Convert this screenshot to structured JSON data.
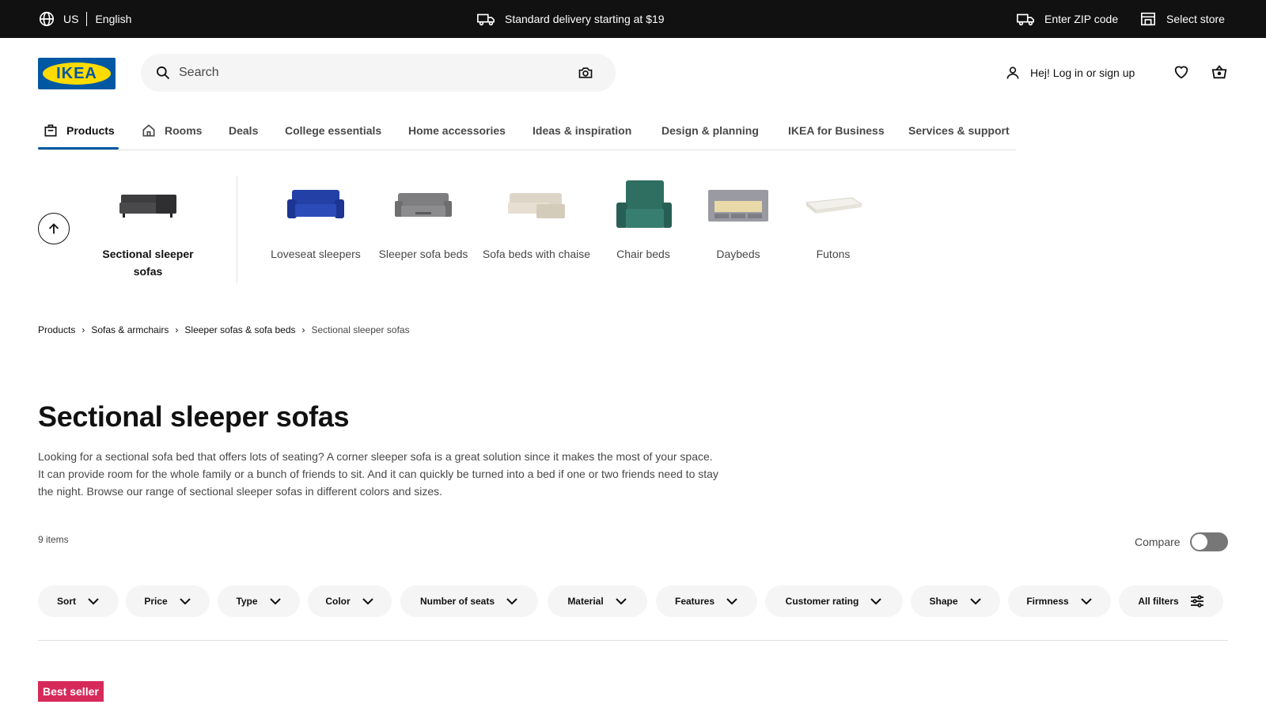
{
  "topbar": {
    "country": "US",
    "language": "English",
    "delivery_text": "Standard delivery starting at $19",
    "zip_label": "Enter ZIP code",
    "store_label": "Select store"
  },
  "header": {
    "logo_text": "IKEA",
    "search_placeholder": "Search",
    "login_label": "Hej! Log in or sign up"
  },
  "nav": {
    "items": [
      {
        "label": "Products"
      },
      {
        "label": "Rooms"
      },
      {
        "label": "Deals"
      },
      {
        "label": "College essentials"
      },
      {
        "label": "Home accessories"
      },
      {
        "label": "Ideas & inspiration"
      },
      {
        "label": "Design & planning"
      },
      {
        "label": "IKEA for Business"
      },
      {
        "label": "Services & support"
      }
    ]
  },
  "categories": {
    "current": "Sectional sleeper sofas",
    "items": [
      {
        "label": "Loveseat sleepers",
        "color": "#1f3fa8"
      },
      {
        "label": "Sleeper sofa beds",
        "color": "#8a8a8a"
      },
      {
        "label": "Sofa beds with chaise",
        "color": "#d9d2c3"
      },
      {
        "label": "Chair beds",
        "color": "#2f6f62"
      },
      {
        "label": "Daybeds",
        "color": "#9a9aa2"
      },
      {
        "label": "Futons",
        "color": "#ecebe6"
      }
    ]
  },
  "breadcrumb": [
    "Products",
    "Sofas & armchairs",
    "Sleeper sofas & sofa beds",
    "Sectional sleeper sofas"
  ],
  "page": {
    "title": "Sectional sleeper sofas",
    "description": "Looking for a sectional sofa bed that offers lots of seating? A corner sleeper sofa is a great solution since it makes the most of your space. It can provide room for the whole family or a bunch of friends to sit. And it can quickly be turned into a bed if one or two friends need to stay the night. Browse our range of sectional sleeper sofas in different colors and sizes.",
    "item_count": "9 items",
    "compare_label": "Compare"
  },
  "filters": [
    "Sort",
    "Price",
    "Type",
    "Color",
    "Number of seats",
    "Material",
    "Features",
    "Customer rating",
    "Shape",
    "Firmness",
    "All filters"
  ],
  "badge": {
    "label": "Best seller",
    "color": "#d62a5a"
  },
  "colors": {
    "brand_blue": "#0058a3",
    "brand_yellow": "#ffdb00",
    "topbar": "#111111"
  }
}
